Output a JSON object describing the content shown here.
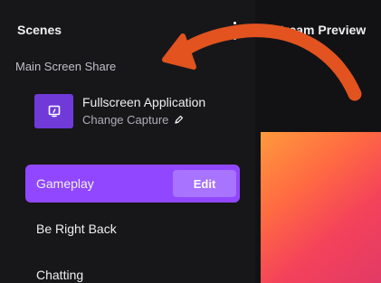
{
  "scenes_panel": {
    "title": "Scenes",
    "section_label": "Main Screen Share",
    "source": {
      "name": "Fullscreen Application",
      "action_label": "Change Capture",
      "icon": "screen-share-icon"
    },
    "scenes": [
      {
        "label": "Gameplay",
        "active": true,
        "edit_label": "Edit"
      },
      {
        "label": "Be Right Back",
        "active": false
      },
      {
        "label": "Chatting",
        "active": false
      }
    ]
  },
  "preview_panel": {
    "title": "Stream Preview"
  },
  "colors": {
    "accent": "#9147ff",
    "edit_button": "#a873ff",
    "source_icon_bg": "#6f3ad8",
    "arrow": "#e2531f",
    "panel_bg": "#17171a"
  }
}
